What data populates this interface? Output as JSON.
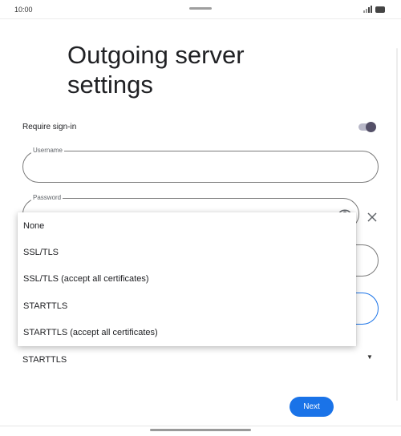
{
  "status_bar": {
    "time": "10:00"
  },
  "page": {
    "title": "Outgoing server settings"
  },
  "require_signin": {
    "label": "Require sign-in",
    "enabled": true
  },
  "username": {
    "label": "Username",
    "value": ""
  },
  "password": {
    "label": "Password",
    "value": ""
  },
  "security": {
    "selected": "STARTTLS"
  },
  "menu": {
    "options": [
      "None",
      "SSL/TLS",
      "SSL/TLS (accept all certificates)",
      "STARTTLS",
      "STARTTLS (accept all certificates)"
    ]
  },
  "actions": {
    "next_label": "Next"
  },
  "colors": {
    "accent": "#1a73e8",
    "toggle_thumb": "#545068",
    "toggle_track": "#b8b8c8"
  },
  "icons": {
    "eye": "eye-icon",
    "close": "close-icon",
    "dropdown": "dropdown-arrow-icon"
  }
}
